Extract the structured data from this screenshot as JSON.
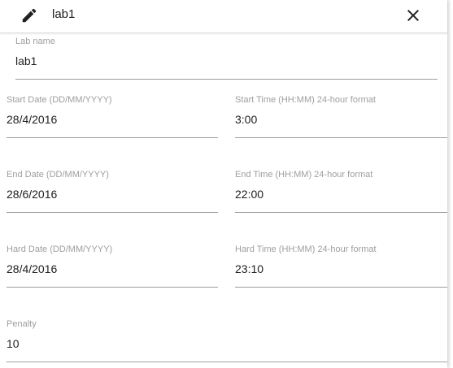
{
  "header": {
    "title": "lab1",
    "edit_icon": "pencil-icon",
    "close_icon": "close-icon"
  },
  "form": {
    "lab_name": {
      "label": "Lab name",
      "value": "lab1"
    },
    "start_date": {
      "label": "Start Date (DD/MM/YYYY)",
      "value": "28/4/2016"
    },
    "start_time": {
      "label": "Start Time (HH:MM) 24-hour format",
      "value": "3:00"
    },
    "end_date": {
      "label": "End Date (DD/MM/YYYY)",
      "value": "28/6/2016"
    },
    "end_time": {
      "label": "End Time (HH:MM) 24-hour format",
      "value": "22:00"
    },
    "hard_date": {
      "label": "Hard Date (DD/MM/YYYY)",
      "value": "28/4/2016"
    },
    "hard_time": {
      "label": "Hard Time (HH:MM) 24-hour format",
      "value": "23:10"
    },
    "penalty": {
      "label": "Penalty",
      "value": "10"
    }
  },
  "colors": {
    "label": "#9e9e9e",
    "text": "#212121",
    "underline": "#9e9e9e"
  }
}
